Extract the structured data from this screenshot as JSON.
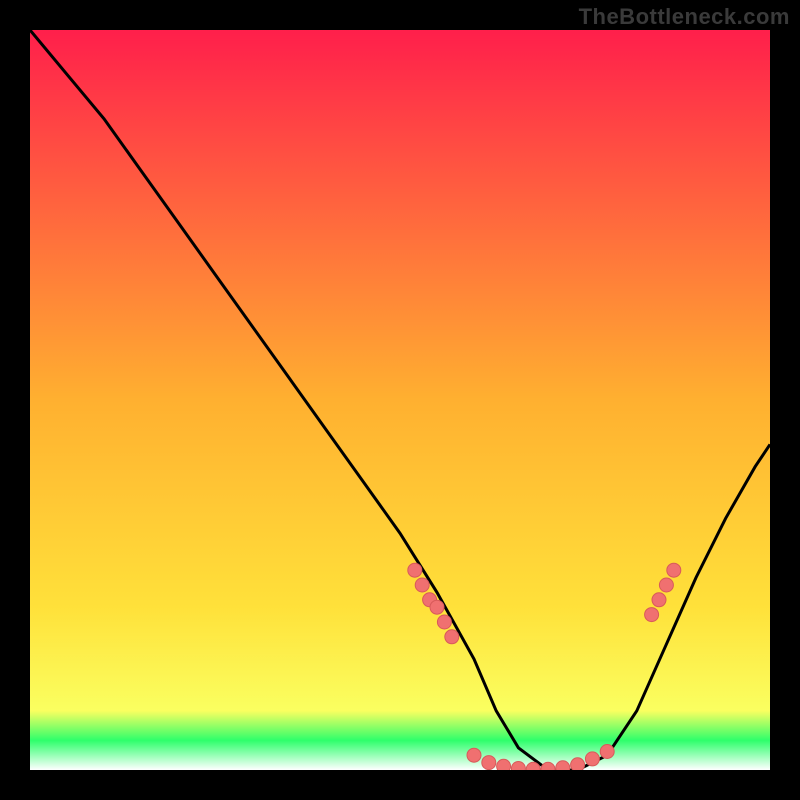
{
  "watermark": "TheBottleneck.com",
  "colors": {
    "background": "#000000",
    "curve": "#000000",
    "dot_fill": "#f07070",
    "dot_stroke": "#d85a5a",
    "gradient_top": "#ff1f4b",
    "gradient_mid": "#ffe13a",
    "gradient_bottom_band": "#2eff6b",
    "gradient_bottom_edge": "#ffffff"
  },
  "chart_data": {
    "type": "line",
    "title": "",
    "xlabel": "",
    "ylabel": "",
    "xlim": [
      0,
      100
    ],
    "ylim": [
      0,
      100
    ],
    "curve": {
      "x": [
        0,
        5,
        10,
        15,
        20,
        25,
        30,
        35,
        40,
        45,
        50,
        55,
        60,
        63,
        66,
        70,
        74,
        78,
        82,
        86,
        90,
        94,
        98,
        100
      ],
      "y": [
        100,
        94,
        88,
        81,
        74,
        67,
        60,
        53,
        46,
        39,
        32,
        24,
        15,
        8,
        3,
        0,
        0,
        2,
        8,
        17,
        26,
        34,
        41,
        44
      ]
    },
    "series": [
      {
        "name": "left-cluster-dots",
        "x": [
          52,
          53,
          54,
          55,
          56,
          57
        ],
        "y": [
          27,
          25,
          23,
          22,
          20,
          18
        ]
      },
      {
        "name": "bottom-cluster-dots",
        "x": [
          60,
          62,
          64,
          66,
          68,
          70,
          72,
          74,
          76,
          78
        ],
        "y": [
          2,
          1,
          0.5,
          0.2,
          0.1,
          0.1,
          0.3,
          0.7,
          1.5,
          2.5
        ]
      },
      {
        "name": "right-cluster-dots",
        "x": [
          84,
          85,
          86,
          87
        ],
        "y": [
          21,
          23,
          25,
          27
        ]
      }
    ]
  }
}
